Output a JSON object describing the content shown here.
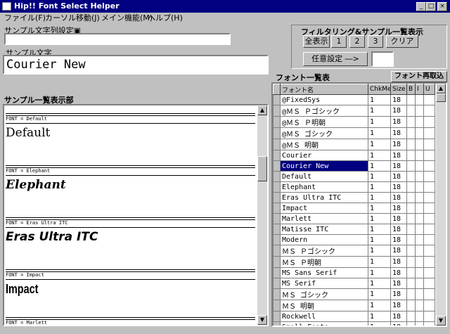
{
  "window": {
    "title": "Hip!! Font Select Helper",
    "min": "_",
    "max": "□",
    "close": "×"
  },
  "menu": [
    "ファイル(F)",
    "カーソル移動(J)",
    "メイン機能(M)",
    "ヘルプ(H)"
  ],
  "sample_setting": {
    "label": "サンプル文字列設定",
    "badge": "▣",
    "value": ""
  },
  "sample_text": {
    "label": "サンプル文字",
    "value": "Courier New"
  },
  "filter": {
    "title": "フィルタリング&サンプル一覧表示",
    "buttons": [
      "全表示",
      "1",
      "2",
      "3",
      "クリア"
    ],
    "custom_label": "任意設定 ―>",
    "custom_value": ""
  },
  "preview": {
    "label": "サンプル一覧表示部",
    "blocks": [
      {
        "font_line": "FONT = Default",
        "sample": "Default"
      },
      {
        "font_line": "FONT = Elephant",
        "sample": "Elephant"
      },
      {
        "font_line": "FONT = Eras Ultra ITC",
        "sample": "Eras Ultra ITC"
      },
      {
        "font_line": "FONT = Impact",
        "sample": "Impact"
      },
      {
        "font_line": "FONT = Marlett",
        "sample": ""
      }
    ]
  },
  "font_list": {
    "label": "フォント一覧表",
    "reload": "フォント再取込",
    "headers": [
      "フォント名",
      "ChkMe!",
      "Size",
      "B",
      "I",
      "U"
    ],
    "selected_index": 6,
    "rows": [
      [
        "@FixedSys",
        "1",
        "18"
      ],
      [
        "@ＭＳ Ｐゴシック",
        "1",
        "18"
      ],
      [
        "@ＭＳ Ｐ明朝",
        "1",
        "18"
      ],
      [
        "@ＭＳ ゴシック",
        "1",
        "18"
      ],
      [
        "@ＭＳ 明朝",
        "1",
        "18"
      ],
      [
        "Courier",
        "1",
        "18"
      ],
      [
        "Courier New",
        "1",
        "18"
      ],
      [
        "Default",
        "1",
        "18"
      ],
      [
        "Elephant",
        "1",
        "18"
      ],
      [
        "Eras Ultra ITC",
        "1",
        "18"
      ],
      [
        "Impact",
        "1",
        "18"
      ],
      [
        "Marlett",
        "1",
        "18"
      ],
      [
        "Matisse ITC",
        "1",
        "18"
      ],
      [
        "Modern",
        "1",
        "18"
      ],
      [
        "ＭＳ Ｐゴシック",
        "1",
        "18"
      ],
      [
        "ＭＳ Ｐ明朝",
        "1",
        "18"
      ],
      [
        "MS Sans Serif",
        "1",
        "18"
      ],
      [
        "MS Serif",
        "1",
        "18"
      ],
      [
        "ＭＳ ゴシック",
        "1",
        "18"
      ],
      [
        "ＭＳ 明朝",
        "1",
        "18"
      ],
      [
        "Rockwell",
        "1",
        "18"
      ],
      [
        "Small Fonts",
        "1",
        "18"
      ]
    ]
  }
}
